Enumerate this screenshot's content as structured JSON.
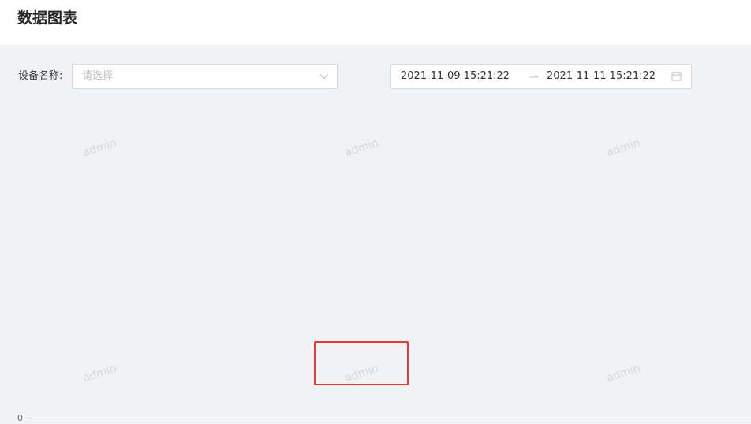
{
  "page": {
    "title": "数据图表"
  },
  "filters": {
    "device_label": "设备名称:",
    "device_placeholder": "请选择",
    "date_start": "2021-11-09 15:21:22",
    "date_end": "2021-11-11 15:21:22"
  },
  "watermark": {
    "text": "admin"
  },
  "chart": {
    "y_axis_zero_label": "0"
  },
  "icons": {
    "select_chevron": "chevron-down-icon",
    "range_separator": "arrow-right-icon",
    "date_picker": "calendar-icon"
  },
  "colors": {
    "background": "#f0f2f5",
    "header_bg": "#ffffff",
    "watermark": "#d4d6db",
    "highlight": "#e53935"
  }
}
